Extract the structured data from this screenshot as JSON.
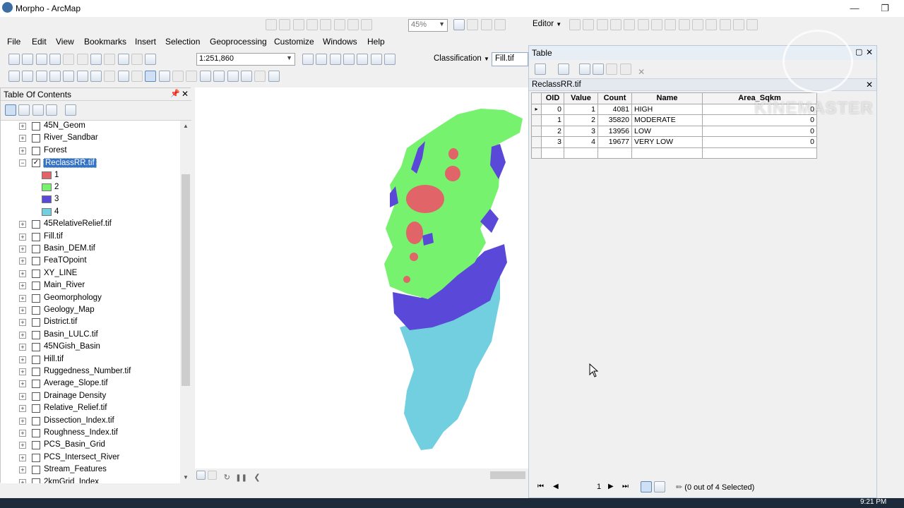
{
  "window": {
    "title": "Morpho - ArcMap"
  },
  "menu": [
    "File",
    "Edit",
    "View",
    "Bookmarks",
    "Insert",
    "Selection",
    "Geoprocessing",
    "Customize",
    "Windows",
    "Help"
  ],
  "toolbar": {
    "zoom_percent": "45%",
    "editor_label": "Editor",
    "scale": "1:251,860",
    "classification_label": "Classification",
    "layer_combo": "Fill.tif"
  },
  "toc": {
    "title": "Table Of Contents",
    "layers": [
      {
        "name": "45N_Geom",
        "checked": false
      },
      {
        "name": "River_Sandbar",
        "checked": false
      },
      {
        "name": "Forest",
        "checked": false
      },
      {
        "name": "ReclassRR.tif",
        "checked": true,
        "selected": true,
        "expanded": true
      },
      {
        "name": "45RelativeRelief.tif",
        "checked": false
      },
      {
        "name": "Fill.tif",
        "checked": false
      },
      {
        "name": "Basin_DEM.tif",
        "checked": false
      },
      {
        "name": "FeaTOpoint",
        "checked": false
      },
      {
        "name": "XY_LINE",
        "checked": false
      },
      {
        "name": "Main_River",
        "checked": false
      },
      {
        "name": "Geomorphology",
        "checked": false
      },
      {
        "name": "Geology_Map",
        "checked": false
      },
      {
        "name": "District.tif",
        "checked": false
      },
      {
        "name": "Basin_LULC.tif",
        "checked": false
      },
      {
        "name": "45NGish_Basin",
        "checked": false
      },
      {
        "name": "Hill.tif",
        "checked": false
      },
      {
        "name": "Ruggedness_Number.tif",
        "checked": false
      },
      {
        "name": "Average_Slope.tif",
        "checked": false
      },
      {
        "name": "Drainage Density",
        "checked": false
      },
      {
        "name": "Relative_Relief.tif",
        "checked": false
      },
      {
        "name": "Dissection_Index.tif",
        "checked": false
      },
      {
        "name": "Roughness_Index.tif",
        "checked": false
      },
      {
        "name": "PCS_Basin_Grid",
        "checked": false
      },
      {
        "name": "PCS_Intersect_River",
        "checked": false
      },
      {
        "name": "Stream_Features",
        "checked": false
      },
      {
        "name": "2kmGrid_Index",
        "checked": false
      }
    ],
    "legend": [
      {
        "label": "1",
        "color": "#e06468"
      },
      {
        "label": "2",
        "color": "#76f26e"
      },
      {
        "label": "3",
        "color": "#5a48d8"
      },
      {
        "label": "4",
        "color": "#72cfe0"
      }
    ]
  },
  "table_window": {
    "title": "Table",
    "table_name": "ReclassRR.tif",
    "columns": [
      "OID",
      "Value",
      "Count",
      "Name",
      "Area_Sqkm"
    ],
    "rows": [
      [
        "0",
        "1",
        "4081",
        "HIGH",
        "0"
      ],
      [
        "1",
        "2",
        "35820",
        "MODERATE",
        "0"
      ],
      [
        "2",
        "3",
        "13956",
        "LOW",
        "0"
      ],
      [
        "3",
        "4",
        "19677",
        "VERY LOW",
        "0"
      ]
    ],
    "page": "1",
    "selection_status": "(0 out of 4 Selected)"
  },
  "watermark": "KINEMASTER",
  "clock": "9:21 PM",
  "colors": {
    "high": "#e06468",
    "moderate": "#76f26e",
    "low": "#5a48d8",
    "very_low": "#72cfe0",
    "selection": "#3372c4"
  }
}
